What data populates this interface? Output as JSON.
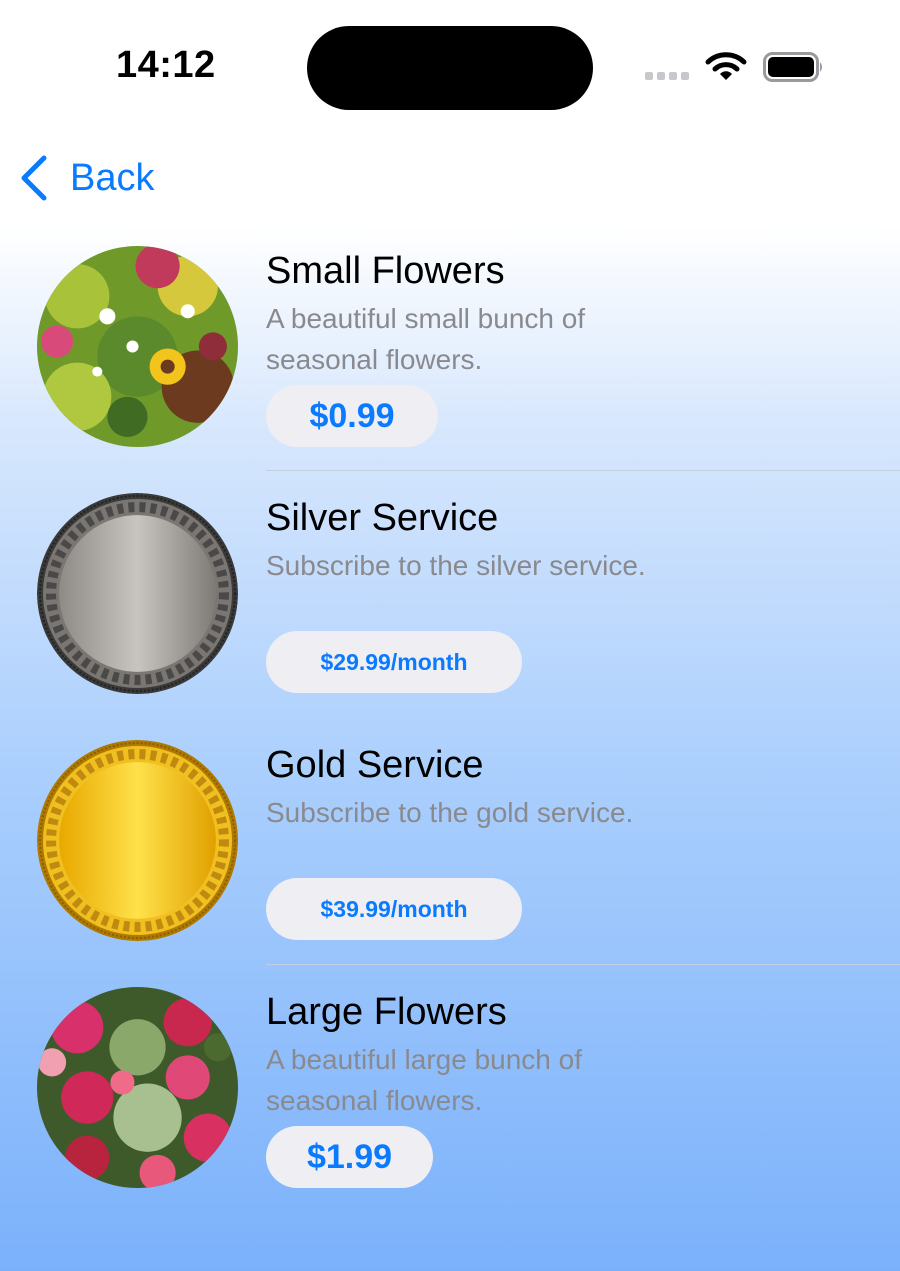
{
  "status_bar": {
    "time": "14:12"
  },
  "nav": {
    "back_label": "Back"
  },
  "colors": {
    "accent": "#0a7aff",
    "button_bg": "#eeeef3",
    "gradient_top": "#ffffff",
    "gradient_bottom": "#7bb1fb"
  },
  "products": [
    {
      "title": "Small Flowers",
      "description": "A beautiful small bunch of seasonal flowers.",
      "price": "$0.99",
      "image": "small-flowers-image"
    },
    {
      "title": "Silver Service",
      "description": "Subscribe to the silver service.",
      "price": "$29.99/month",
      "image": "silver-medal-image"
    },
    {
      "title": "Gold Service",
      "description": "Subscribe to the gold service.",
      "price": "$39.99/month",
      "image": "gold-medal-image"
    },
    {
      "title": "Large Flowers",
      "description": "A beautiful large bunch of seasonal flowers.",
      "price": "$1.99",
      "image": "large-flowers-image"
    }
  ]
}
